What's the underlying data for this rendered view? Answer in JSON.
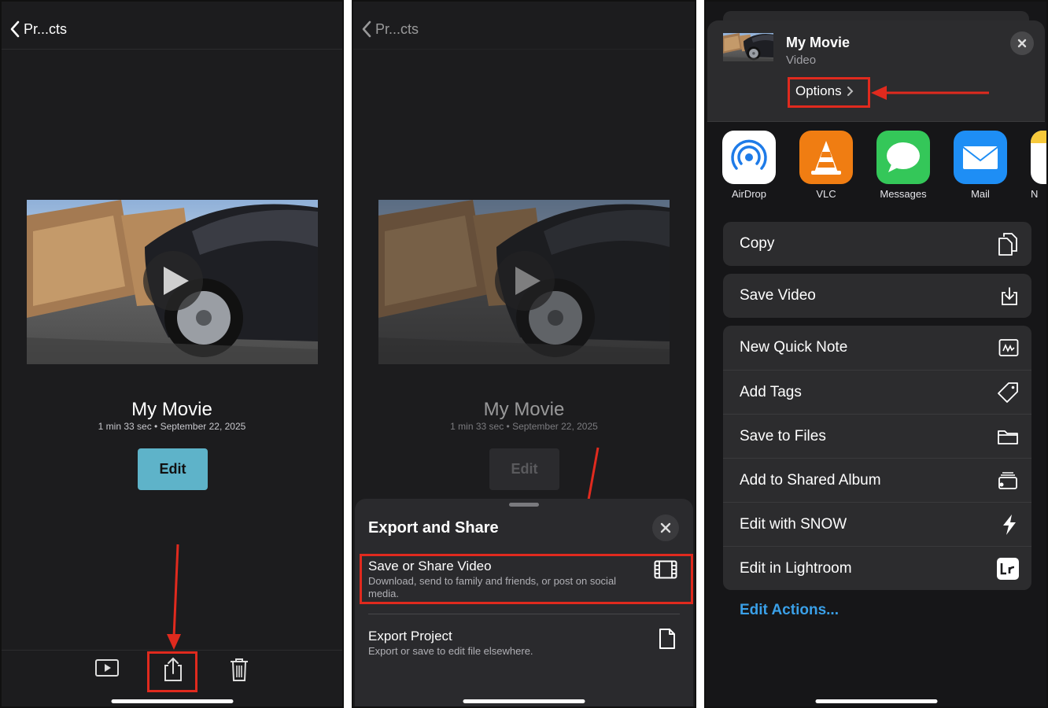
{
  "panel1": {
    "back_label": "Pr...cts",
    "movie_title": "My Movie",
    "movie_meta": "1 min 33 sec • September 22, 2025",
    "edit_label": "Edit",
    "toolbar_icons": [
      "play-preview-icon",
      "share-icon",
      "trash-icon"
    ]
  },
  "panel2": {
    "back_label": "Pr...cts",
    "movie_title": "My Movie",
    "movie_meta": "1 min 33 sec • September 22, 2025",
    "edit_label": "Edit",
    "sheet": {
      "title": "Export and Share",
      "options": [
        {
          "title": "Save or Share Video",
          "desc": "Download, send to family and friends, or post on social media.",
          "icon": "film-icon"
        },
        {
          "title": "Export Project",
          "desc": "Export or save to edit file elsewhere.",
          "icon": "document-icon"
        }
      ]
    }
  },
  "panel3": {
    "item_name": "My Movie",
    "item_type": "Video",
    "options_label": "Options",
    "apps": [
      {
        "label": "AirDrop",
        "icon": "airdrop-icon",
        "color": "#ffffff"
      },
      {
        "label": "VLC",
        "icon": "vlc-icon",
        "color": "#f07d12"
      },
      {
        "label": "Messages",
        "icon": "messages-icon",
        "color": "#34c759"
      },
      {
        "label": "Mail",
        "icon": "mail-icon",
        "color": "#1e8ef5"
      },
      {
        "label": "N",
        "icon": "notes-icon",
        "color": "#ffffff"
      }
    ],
    "group1": [
      {
        "label": "Copy",
        "icon": "copy-icon"
      }
    ],
    "group2": [
      {
        "label": "Save Video",
        "icon": "save-download-icon"
      }
    ],
    "group3": [
      {
        "label": "New Quick Note",
        "icon": "quick-note-icon"
      },
      {
        "label": "Add Tags",
        "icon": "tag-icon"
      },
      {
        "label": "Save to Files",
        "icon": "folder-icon"
      },
      {
        "label": "Add to Shared Album",
        "icon": "shared-album-icon"
      },
      {
        "label": "Edit with SNOW",
        "icon": "snow-bolt-icon"
      },
      {
        "label": "Edit in Lightroom",
        "icon": "lightroom-icon"
      }
    ],
    "edit_actions_label": "Edit Actions..."
  },
  "colors": {
    "highlight_red": "#e02a1e",
    "edit_button": "#5eb3c9",
    "link_blue": "#3aa0e8",
    "panel_bg": "#1c1c1e"
  }
}
